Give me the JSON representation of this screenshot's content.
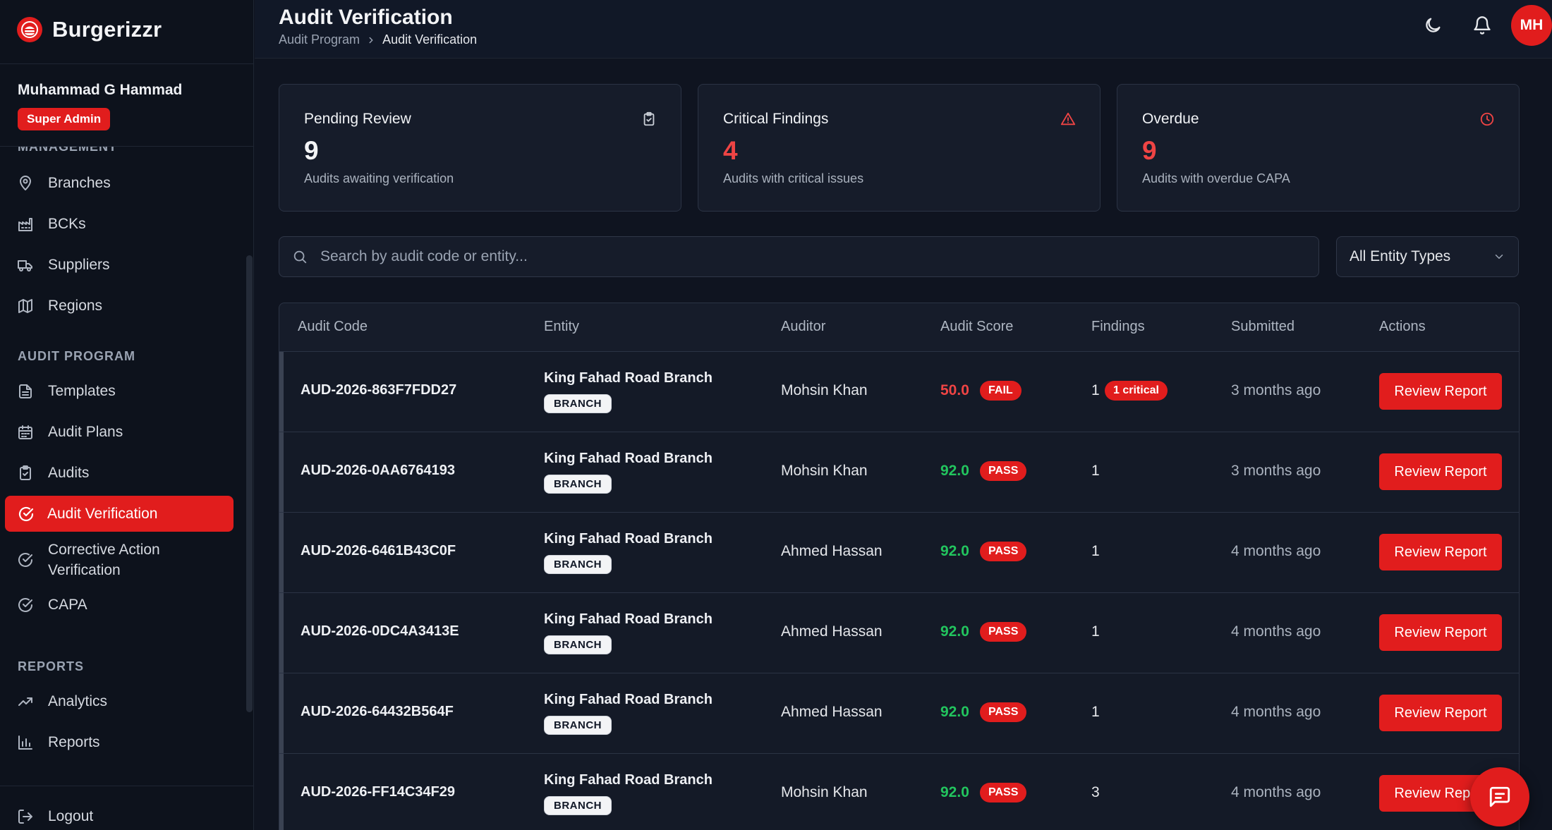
{
  "brand": {
    "name": "Burgerizzr"
  },
  "user": {
    "name": "Muhammad G Hammad",
    "role": "Super Admin",
    "initials": "MH"
  },
  "sidebar": {
    "sections": {
      "management": "MANAGEMENT",
      "audit_program": "AUDIT PROGRAM",
      "reports": "REPORTS"
    },
    "items": {
      "branches": "Branches",
      "bcks": "BCKs",
      "suppliers": "Suppliers",
      "regions": "Regions",
      "templates": "Templates",
      "audit_plans": "Audit Plans",
      "audits": "Audits",
      "audit_verification": "Audit Verification",
      "corrective_action_verification": "Corrective Action Verification",
      "capa": "CAPA",
      "analytics": "Analytics",
      "reports": "Reports"
    },
    "logout": "Logout"
  },
  "header": {
    "title": "Audit Verification",
    "breadcrumb": [
      "Audit Program",
      "Audit Verification"
    ]
  },
  "stats": [
    {
      "label": "Pending Review",
      "value": "9",
      "sub": "Audits awaiting verification",
      "icon": "clipboard-check-icon",
      "color": "#f3f4f6"
    },
    {
      "label": "Critical Findings",
      "value": "4",
      "sub": "Audits with critical issues",
      "icon": "alert-triangle-icon",
      "color": "#ef4444"
    },
    {
      "label": "Overdue",
      "value": "9",
      "sub": "Audits with overdue CAPA",
      "icon": "clock-icon",
      "color": "#ef4444"
    }
  ],
  "search": {
    "placeholder": "Search by audit code or entity...",
    "value": ""
  },
  "filter": {
    "selected": "All Entity Types"
  },
  "table": {
    "columns": [
      "Audit Code",
      "Entity",
      "Auditor",
      "Audit Score",
      "Findings",
      "Submitted",
      "Actions"
    ],
    "action_label": "Review Report",
    "rows": [
      {
        "code": "AUD-2026-863F7FDD27",
        "entity": "King Fahad Road Branch",
        "entity_type": "BRANCH",
        "auditor": "Mohsin Khan",
        "score": "50.0",
        "result": "FAIL",
        "findings": "1",
        "critical": "1 critical",
        "submitted": "3 months ago"
      },
      {
        "code": "AUD-2026-0AA6764193",
        "entity": "King Fahad Road Branch",
        "entity_type": "BRANCH",
        "auditor": "Mohsin Khan",
        "score": "92.0",
        "result": "PASS",
        "findings": "1",
        "critical": "",
        "submitted": "3 months ago"
      },
      {
        "code": "AUD-2026-6461B43C0F",
        "entity": "King Fahad Road Branch",
        "entity_type": "BRANCH",
        "auditor": "Ahmed Hassan",
        "score": "92.0",
        "result": "PASS",
        "findings": "1",
        "critical": "",
        "submitted": "4 months ago"
      },
      {
        "code": "AUD-2026-0DC4A3413E",
        "entity": "King Fahad Road Branch",
        "entity_type": "BRANCH",
        "auditor": "Ahmed Hassan",
        "score": "92.0",
        "result": "PASS",
        "findings": "1",
        "critical": "",
        "submitted": "4 months ago"
      },
      {
        "code": "AUD-2026-64432B564F",
        "entity": "King Fahad Road Branch",
        "entity_type": "BRANCH",
        "auditor": "Ahmed Hassan",
        "score": "92.0",
        "result": "PASS",
        "findings": "1",
        "critical": "",
        "submitted": "4 months ago"
      },
      {
        "code": "AUD-2026-FF14C34F29",
        "entity": "King Fahad Road Branch",
        "entity_type": "BRANCH",
        "auditor": "Mohsin Khan",
        "score": "92.0",
        "result": "PASS",
        "findings": "3",
        "critical": "",
        "submitted": "4 months ago"
      }
    ]
  },
  "colors": {
    "accent": "#e11d1d",
    "pass": "#22c55e",
    "fail": "#ef4444"
  }
}
